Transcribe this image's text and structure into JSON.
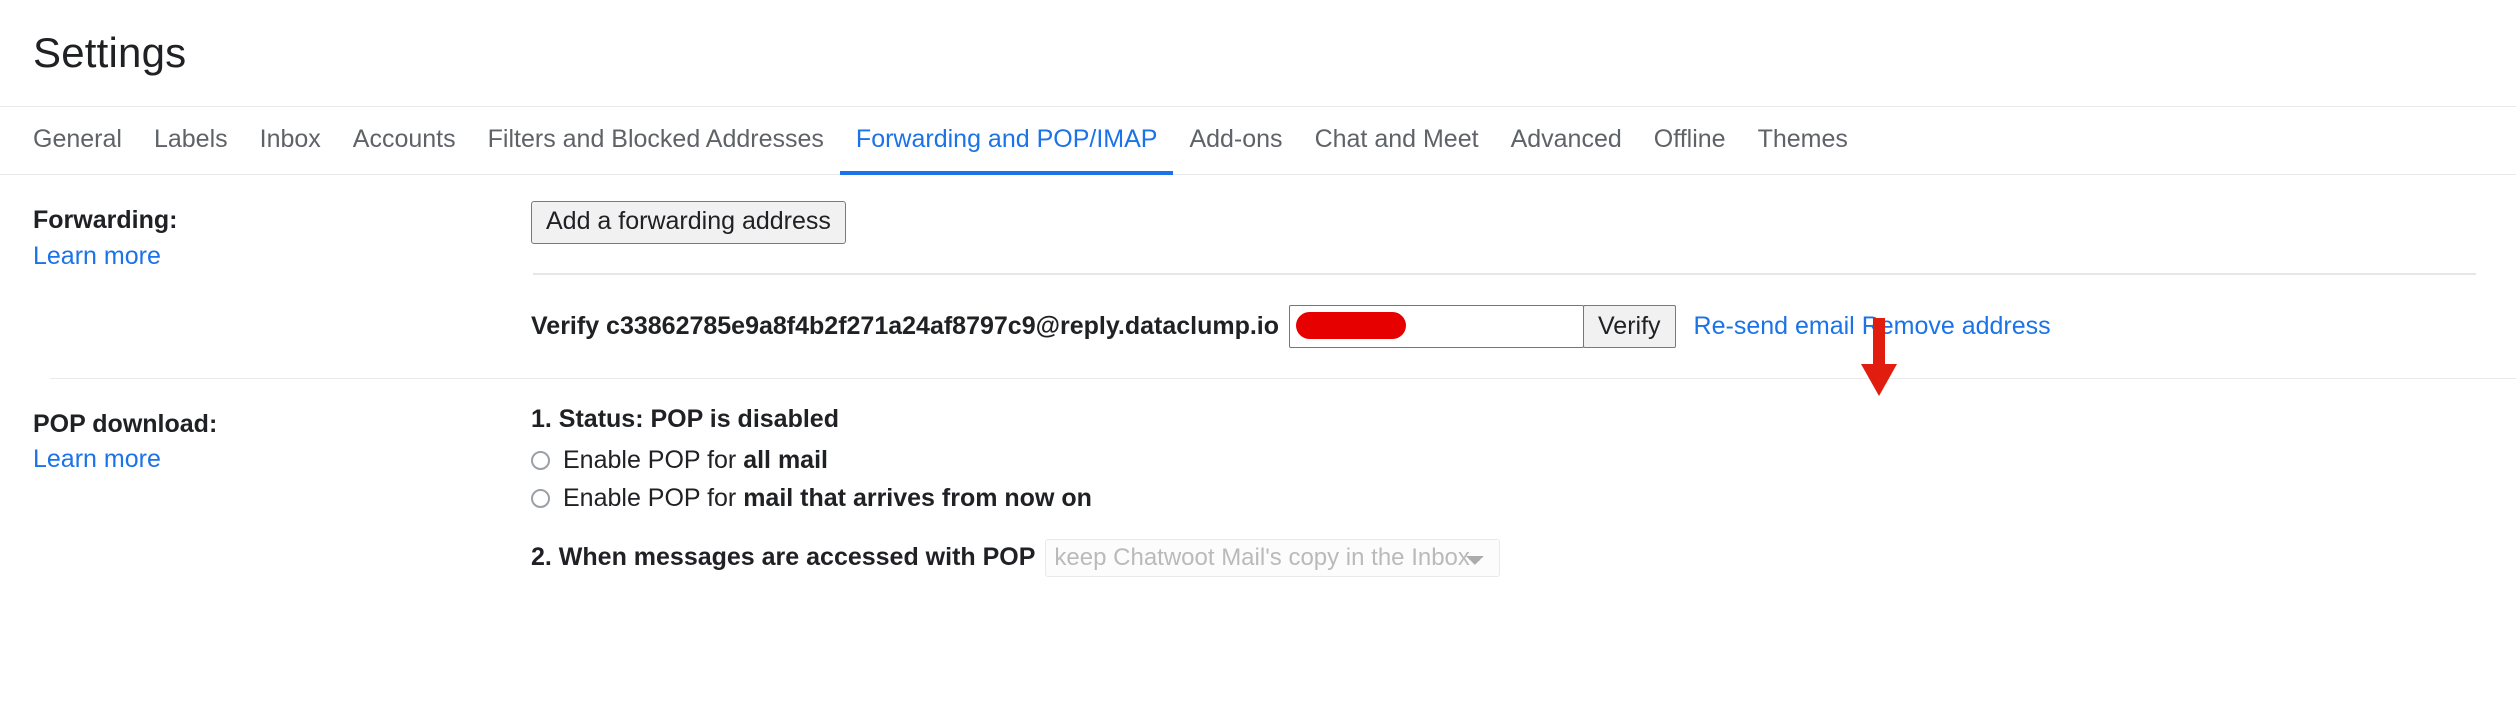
{
  "header": {
    "title": "Settings"
  },
  "tabs": [
    {
      "label": "General",
      "active": false
    },
    {
      "label": "Labels",
      "active": false
    },
    {
      "label": "Inbox",
      "active": false
    },
    {
      "label": "Accounts",
      "active": false
    },
    {
      "label": "Filters and Blocked Addresses",
      "active": false
    },
    {
      "label": "Forwarding and POP/IMAP",
      "active": true
    },
    {
      "label": "Add-ons",
      "active": false
    },
    {
      "label": "Chat and Meet",
      "active": false
    },
    {
      "label": "Advanced",
      "active": false
    },
    {
      "label": "Offline",
      "active": false
    },
    {
      "label": "Themes",
      "active": false
    }
  ],
  "forwarding": {
    "label": "Forwarding:",
    "learn_more": "Learn more",
    "add_address_button": "Add a forwarding address",
    "verify_prefix": "Verify c33862785e9a8f4b2f271a24af8797c9@reply.dataclump.io",
    "code_input_value": "",
    "code_input_placeholder": "",
    "verify_button": "Verify",
    "resend_link": "Re-send email",
    "remove_link": "Remove address"
  },
  "pop": {
    "label": "POP download:",
    "learn_more": "Learn more",
    "status_line": "1. Status: POP is disabled",
    "options": [
      {
        "prefix": "Enable POP for ",
        "strong": "all mail",
        "checked": false
      },
      {
        "prefix": "Enable POP for ",
        "strong": "mail that arrives from now on",
        "checked": false
      }
    ],
    "step2_label": "2. When messages are accessed with POP",
    "step2_selected": "keep Chatwoot Mail's copy in the Inbox",
    "step2_disabled": true
  },
  "annotation": {
    "arrow_color": "#e11d10",
    "points_at": "verify-button"
  },
  "colors": {
    "accent": "#1a73e8",
    "text": "#202124",
    "muted": "#5f6368",
    "redaction": "#e60000",
    "divider": "#e8eaed"
  }
}
